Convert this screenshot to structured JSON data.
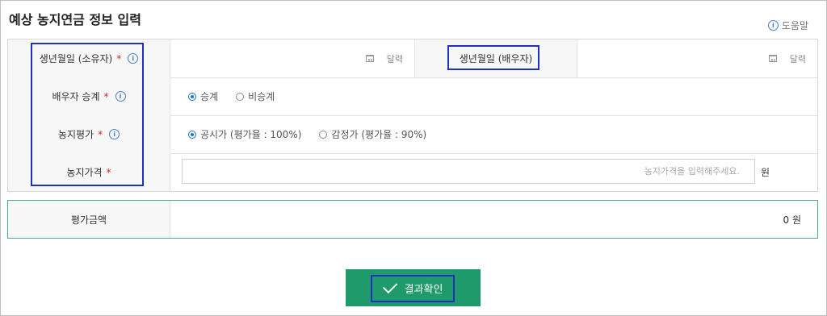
{
  "header": {
    "title": "예상 농지연금 정보 입력",
    "help_label": "도움말"
  },
  "form": {
    "birth_owner": {
      "label": "생년월일 (소유자)",
      "calendar_label": "달력"
    },
    "birth_spouse": {
      "label": "생년월일 (배우자)",
      "calendar_label": "달력"
    },
    "spouse_succession": {
      "label": "배우자 승계",
      "options": [
        "승계",
        "비승계"
      ],
      "selected": "승계"
    },
    "land_valuation": {
      "label": "농지평가",
      "options": [
        "공시가 (평가율 : 100%)",
        "감정가 (평가율 : 90%)"
      ],
      "selected": "공시가 (평가율 : 100%)"
    },
    "land_price": {
      "label": "농지가격",
      "placeholder": "농지가격을 입력해주세요.",
      "unit": "원"
    }
  },
  "result": {
    "label": "평가금액",
    "value": "0 원"
  },
  "actions": {
    "confirm_label": "결과확인"
  },
  "colors": {
    "accent_green": "#1e9a6b",
    "highlight_blue": "#1f2fc6",
    "required_red": "#d22",
    "info_blue": "#4a7bd0"
  }
}
